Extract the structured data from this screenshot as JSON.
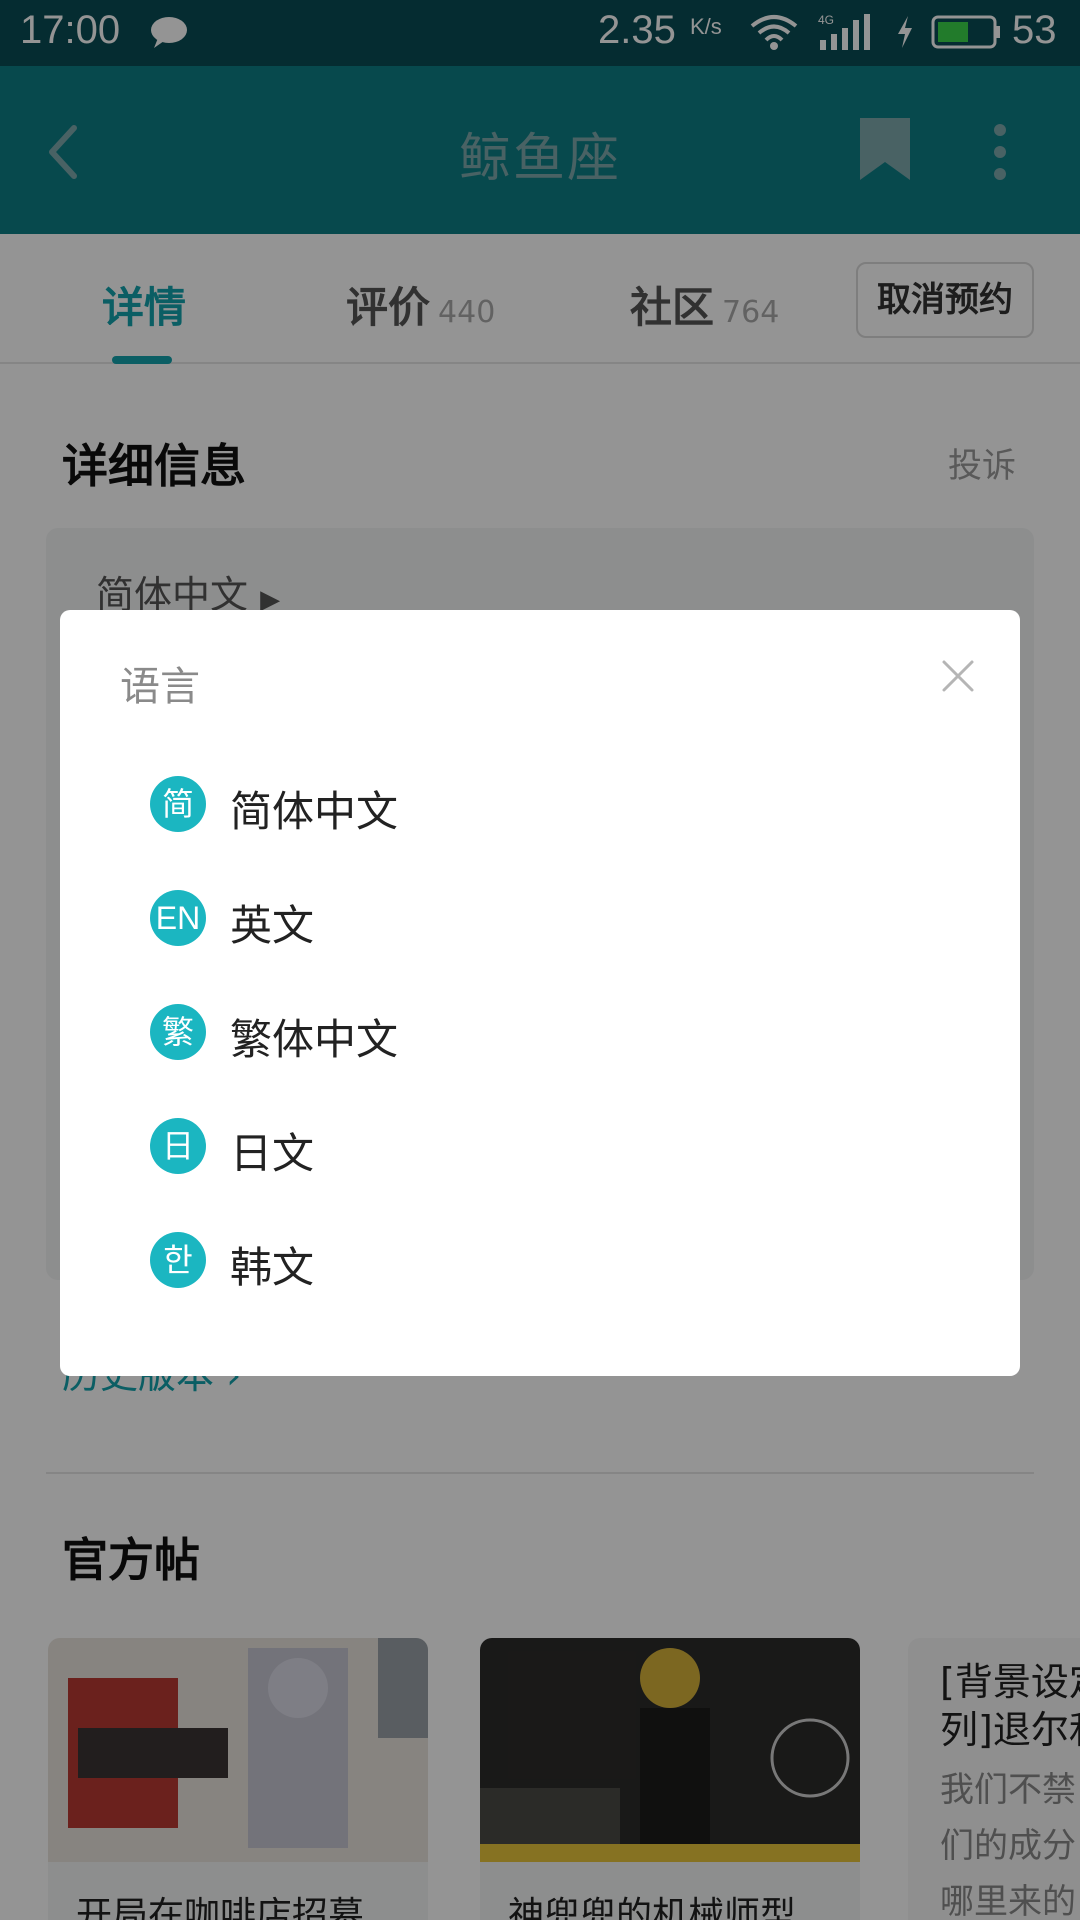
{
  "status_bar": {
    "time": "17:00",
    "net_speed": "2.35",
    "net_speed_unit": "K/s",
    "signal_type": "4G",
    "battery": "53"
  },
  "app_bar": {
    "title": "鲸鱼座"
  },
  "tabs": [
    {
      "label": "详情",
      "count": ""
    },
    {
      "label": "评价",
      "count": "440"
    },
    {
      "label": "社区",
      "count": "764"
    }
  ],
  "cancel_button": "取消预约",
  "details": {
    "title": "详细信息",
    "complain": "投诉",
    "current_language": "简体中文",
    "history_link": "历史版本 ›"
  },
  "official_posts": {
    "title": "官方帖",
    "cards": [
      {
        "caption": "开局在咖啡店招募"
      },
      {
        "caption": "神兜兜的机械师型"
      },
      {
        "title_line1": "[背景设定",
        "title_line2": "列]退尔和",
        "body_line1": "我们不禁",
        "body_line2": "们的成分",
        "body_line3": "哪里来的"
      }
    ]
  },
  "language_dialog": {
    "title": "语言",
    "items": [
      {
        "badge": "简",
        "label": "简体中文"
      },
      {
        "badge": "EN",
        "label": "英文"
      },
      {
        "badge": "繁",
        "label": "繁体中文"
      },
      {
        "badge": "日",
        "label": "日文"
      },
      {
        "badge": "한",
        "label": "韩文"
      }
    ]
  },
  "colors": {
    "status_bar": "#0a4d55",
    "app_bar": "#0d7e86",
    "accent": "#14a3ac",
    "badge": "#1bb6c1"
  }
}
